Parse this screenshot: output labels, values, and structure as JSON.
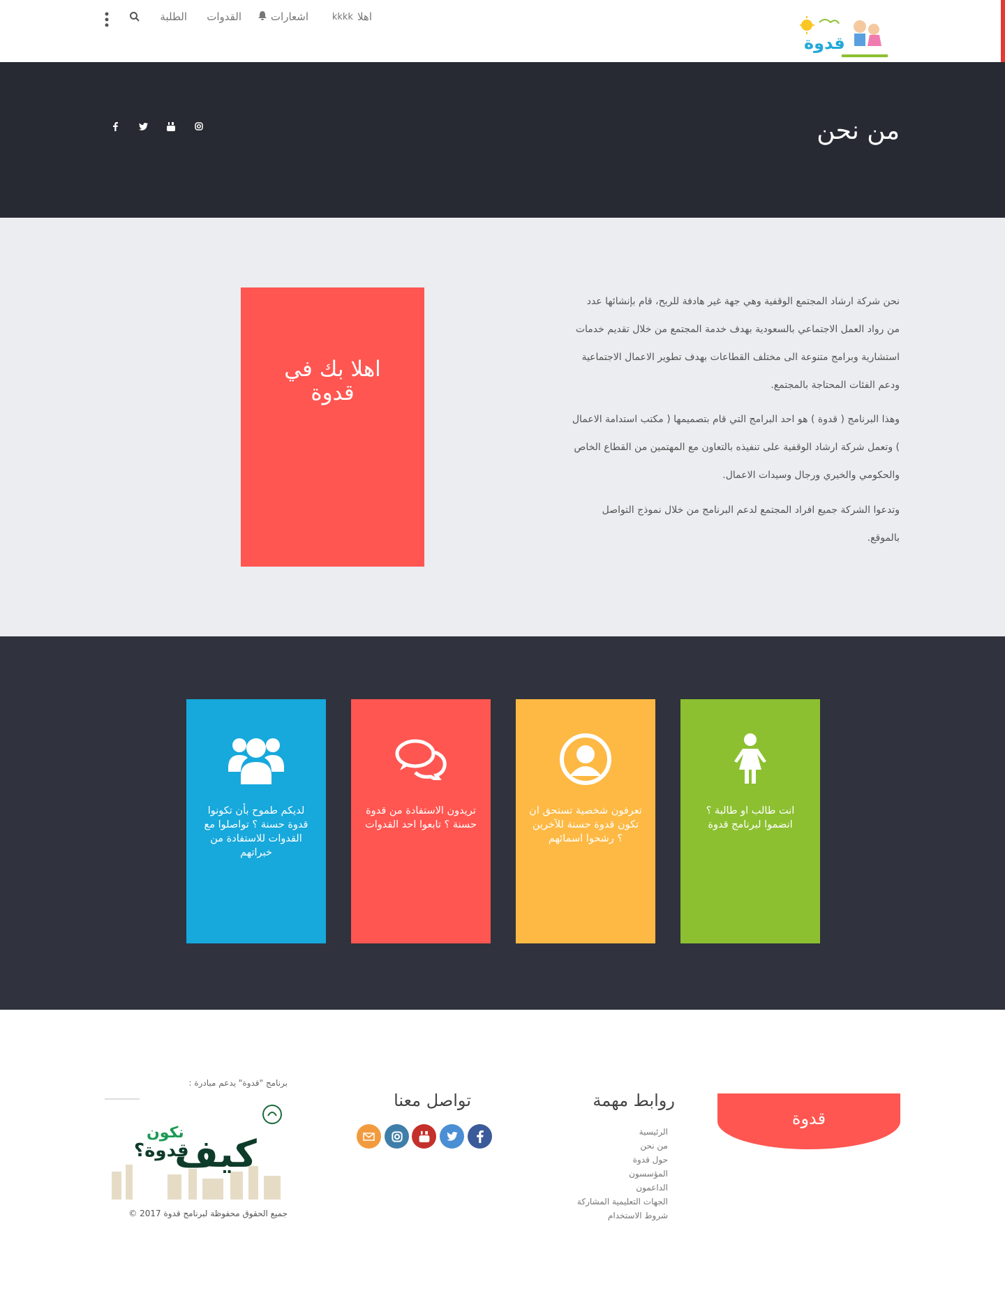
{
  "header": {
    "greeting": "اهلا",
    "username": "kkkk",
    "notifications_label": "اشعارات",
    "role_models_label": "القدوات",
    "students_label": "الطلبة"
  },
  "page": {
    "title": "من نحن"
  },
  "about": {
    "paragraphs": [
      "نحن شركة ارشاد المجتمع الوقفية وهي جهة غير هادفة للربح، قام بإنشائها عدد من رواد العمل الاجتماعي بالسعودية بهدف خدمة المجتمع من خلال تقديم خدمات استشارية وبرامج متنوعة الى مختلف القطاعات بهدف تطوير الاعمال الاجتماعية ودعم الفئات المحتاجة بالمجتمع.",
      "وهذا البرنامج ( قدوة ) هو احد البرامج التي قام بتصميمها ( مكتب استدامة الاعمال ) وتعمل شركة ارشاد الوقفية على تنفيذه بالتعاون مع المهتمين من القطاع الخاص والحكومي والخيري ورجال وسيدات الاعمال.",
      "وتدعوا الشركة جميع افراد المجتمع لدعم البرنامج من خلال نموذج التواصل بالموقع."
    ],
    "welcome_line1": "اهلا بك في",
    "welcome_line2": "قدوة"
  },
  "cards": [
    {
      "text": "انت طالب او طالبة ؟ انضموا لبرنامج قدوة",
      "color": "#8cc031",
      "icon": "student-icon"
    },
    {
      "text": "تعرفون شخصية تستحق ان تكون قدوة حسنة للآخرين ؟ رشحوا اسمائهم",
      "color": "#fdb944",
      "icon": "user-circle-icon"
    },
    {
      "text": "تريدون الاستفادة من قدوة حسنة ؟ تابعوا احد القدوات",
      "color": "#ff5651",
      "icon": "chat-bubbles-icon"
    },
    {
      "text": "لديكم طموح بأن تكونوا قدوة حسنة ؟ تواصلوا مع القدوات للاستفادة من خبراتهم",
      "color": "#17a8dc",
      "icon": "group-icon"
    }
  ],
  "footer": {
    "brand": "قدوة",
    "links_heading": "روابط مهمة",
    "links": [
      "الرئيسية",
      "من نحن",
      "حول قدوة",
      "المؤسسون",
      "الداعمون",
      "الجهات التعليمية المشاركة",
      "شروط الاستخدام"
    ],
    "contact_heading": "تواصل معنا",
    "support_note": "برنامج \"قدوة\" يدعم مبادرة :",
    "initiative_line1": "كيف",
    "initiative_line2": "نكون",
    "initiative_line3": "قدوة؟",
    "copyright": "جميع الحقوق محفوظة لبرنامج قدوة 2017 ©",
    "logo_text": "قدوة"
  },
  "colors": {
    "accent": "#ff5651",
    "dark": "#272a32",
    "cards_bg": "#30323d"
  }
}
